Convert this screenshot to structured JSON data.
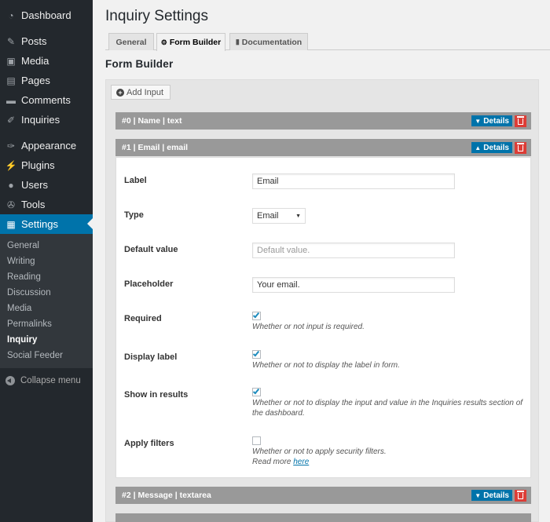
{
  "sidebar": {
    "groups": [
      [
        {
          "label": "Dashboard",
          "icon": "dashboard-icon"
        }
      ],
      [
        {
          "label": "Posts",
          "icon": "pin-icon"
        },
        {
          "label": "Media",
          "icon": "media-icon"
        },
        {
          "label": "Pages",
          "icon": "pages-icon"
        },
        {
          "label": "Comments",
          "icon": "comments-icon"
        },
        {
          "label": "Inquiries",
          "icon": "edit-icon"
        }
      ],
      [
        {
          "label": "Appearance",
          "icon": "brush-icon"
        },
        {
          "label": "Plugins",
          "icon": "plugin-icon"
        },
        {
          "label": "Users",
          "icon": "users-icon"
        },
        {
          "label": "Tools",
          "icon": "wrench-icon"
        },
        {
          "label": "Settings",
          "icon": "settings-icon",
          "active": true
        }
      ]
    ],
    "submenu": [
      "General",
      "Writing",
      "Reading",
      "Discussion",
      "Media",
      "Permalinks",
      "Inquiry",
      "Social Feeder"
    ],
    "submenu_current": "Inquiry",
    "collapse_label": "Collapse menu"
  },
  "page": {
    "title": "Inquiry Settings",
    "tabs": [
      {
        "label": "General",
        "icon": ""
      },
      {
        "label": "Form Builder",
        "icon": "cogs-icon",
        "active": true
      },
      {
        "label": "Documentation",
        "icon": "book-icon"
      }
    ],
    "section_title": "Form Builder",
    "add_input_label": "Add Input"
  },
  "inputs": [
    {
      "title": "#0 | Name | text",
      "details_label": "Details",
      "expanded": false
    },
    {
      "title": "#1 | Email | email",
      "details_label": "Details",
      "expanded": true
    },
    {
      "title": "#2 | Message | textarea",
      "details_label": "Details",
      "expanded": false
    }
  ],
  "detail": {
    "label": {
      "label": "Label",
      "value": "Email"
    },
    "type": {
      "label": "Type",
      "value": "Email"
    },
    "default_value": {
      "label": "Default value",
      "placeholder": "Default value."
    },
    "placeholder": {
      "label": "Placeholder",
      "value": "Your email."
    },
    "required": {
      "label": "Required",
      "checked": true,
      "desc": "Whether or not input is required."
    },
    "display_label": {
      "label": "Display label",
      "checked": true,
      "desc": "Whether or not to display the label in form."
    },
    "show_in_results": {
      "label": "Show in results",
      "checked": true,
      "desc": "Whether or not to display the input and value in the Inquiries results section of the dashboard."
    },
    "apply_filters": {
      "label": "Apply filters",
      "checked": false,
      "desc": "Whether or not to apply security filters.",
      "read_more": "Read more",
      "link_text": "here"
    }
  }
}
